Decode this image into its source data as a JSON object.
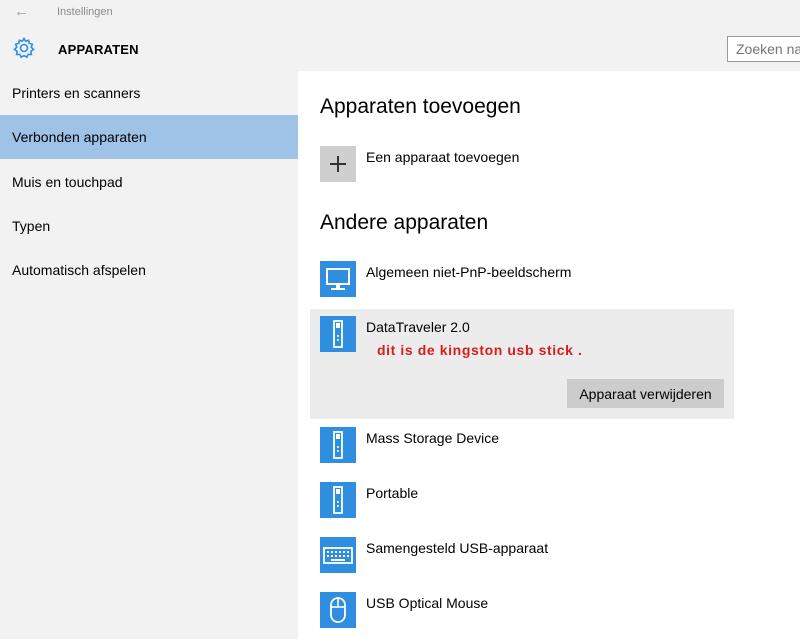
{
  "window": {
    "back_glyph": "←",
    "title": "Instellingen"
  },
  "header": {
    "title": "APPARATEN",
    "icon": "gear-icon",
    "search_placeholder": "Zoeken naar een instelling"
  },
  "sidebar": {
    "items": [
      {
        "label": "Printers en scanners",
        "active": false
      },
      {
        "label": "Verbonden apparaten",
        "active": true
      },
      {
        "label": "Muis en touchpad",
        "active": false
      },
      {
        "label": "Typen",
        "active": false
      },
      {
        "label": "Automatisch afspelen",
        "active": false
      }
    ]
  },
  "main": {
    "add_section": {
      "title": "Apparaten toevoegen",
      "add_label": "Een apparaat toevoegen",
      "add_glyph": "+"
    },
    "other_section": {
      "title": "Andere apparaten"
    },
    "devices": [
      {
        "name": "Algemeen niet-PnP-beeldscherm",
        "icon": "monitor-icon"
      },
      {
        "name": "DataTraveler 2.0",
        "icon": "usb-drive-icon",
        "annotation": "dit is de kingston usb stick .",
        "remove_label": "Apparaat verwijderen"
      },
      {
        "name": "Mass Storage Device",
        "icon": "usb-drive-icon"
      },
      {
        "name": "Portable",
        "icon": "usb-drive-icon"
      },
      {
        "name": "Samengesteld USB-apparaat",
        "icon": "keyboard-icon"
      },
      {
        "name": "USB Optical Mouse",
        "icon": "mouse-icon"
      }
    ]
  },
  "colors": {
    "accent": "#2f8ee0",
    "selected_nav": "#9fc3e7",
    "annotation": "#d81d1d"
  }
}
